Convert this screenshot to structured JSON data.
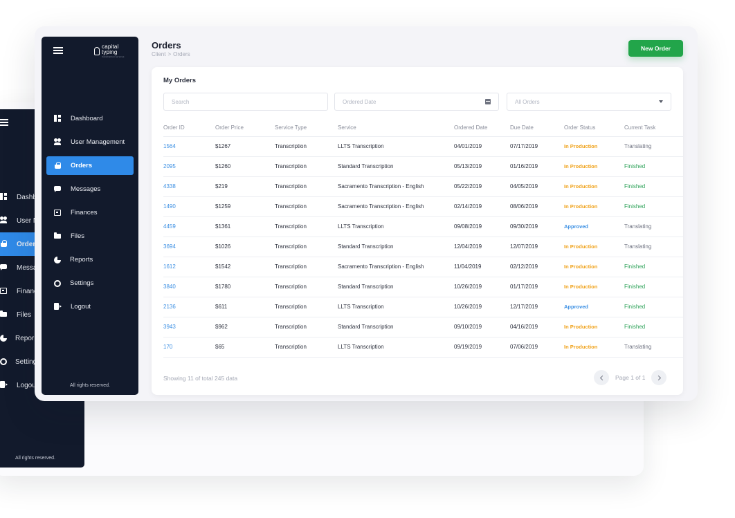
{
  "app": {
    "logo_text": "capital",
    "logo_text2": "typing",
    "logo_sub": "transcription services"
  },
  "sidebar": {
    "items": [
      {
        "label": "Dashboard",
        "icon": "dashboard-icon"
      },
      {
        "label": "User Management",
        "icon": "users-icon"
      },
      {
        "label": "Orders",
        "icon": "basket-icon",
        "active": true
      },
      {
        "label": "Messages",
        "icon": "chat-icon"
      },
      {
        "label": "Finances",
        "icon": "wallet-icon"
      },
      {
        "label": "Files",
        "icon": "folder-icon"
      },
      {
        "label": "Reports",
        "icon": "pie-chart-icon"
      },
      {
        "label": "Settings",
        "icon": "gear-icon"
      },
      {
        "label": "Logout",
        "icon": "logout-icon"
      }
    ],
    "footer": "All rights reserved."
  },
  "back_sidebar": {
    "items": [
      "Dashb",
      "User M",
      "Order",
      "Messa",
      "Financ",
      "Files",
      "Repor",
      "Setting",
      "Logou"
    ],
    "footer": "All rights reserved."
  },
  "header": {
    "title": "Orders",
    "breadcrumb": [
      "Client",
      ">",
      "Orders"
    ],
    "new_order_label": "New Order"
  },
  "card": {
    "title": "My Orders",
    "search_placeholder": "Search",
    "date_placeholder": "Ordered Date",
    "status_selected": "All Orders"
  },
  "table": {
    "columns": [
      "Order ID",
      "Order Price",
      "Service Type",
      "Service",
      "Ordered Date",
      "Due Date",
      "Order Status",
      "Current Task"
    ],
    "rows": [
      [
        "1564",
        "$1267",
        "Transcription",
        "LLTS Transcription",
        "04/01/2019",
        "07/17/2019",
        "In Production",
        "Translating"
      ],
      [
        "2095",
        "$1260",
        "Transcription",
        "Standard Transcription",
        "05/13/2019",
        "01/16/2019",
        "In Production",
        "Finished"
      ],
      [
        "4338",
        "$219",
        "Transcription",
        "Sacramento Transcription - English",
        "05/22/2019",
        "04/05/2019",
        "In Production",
        "Finished"
      ],
      [
        "1490",
        "$1259",
        "Transcription",
        "Sacramento Transcription - English",
        "02/14/2019",
        "08/06/2019",
        "In Production",
        "Finished"
      ],
      [
        "4459",
        "$1361",
        "Transcription",
        "LLTS Transcription",
        "09/08/2019",
        "09/30/2019",
        "Approved",
        "Translating"
      ],
      [
        "3694",
        "$1026",
        "Transcription",
        "Standard Transcription",
        "12/04/2019",
        "12/07/2019",
        "In Production",
        "Translating"
      ],
      [
        "1612",
        "$1542",
        "Transcription",
        "Sacramento Transcription - English",
        "11/04/2019",
        "02/12/2019",
        "In Production",
        "Finished"
      ],
      [
        "3840",
        "$1780",
        "Transcription",
        "Standard Transcription",
        "10/26/2019",
        "01/17/2019",
        "In Production",
        "Finished"
      ],
      [
        "2136",
        "$611",
        "Transcription",
        "LLTS Transcription",
        "10/26/2019",
        "12/17/2019",
        "Approved",
        "Finished"
      ],
      [
        "3943",
        "$962",
        "Transcription",
        "Standard Transcription",
        "09/10/2019",
        "04/16/2019",
        "In Production",
        "Finished"
      ],
      [
        "170",
        "$65",
        "Transcription",
        "LLTS Transcription",
        "09/19/2019",
        "07/06/2019",
        "In Production",
        "Translating"
      ]
    ]
  },
  "footer": {
    "showing": "Showing 11 of total 245 data",
    "page_info": "Page 1 of 1"
  },
  "colors": {
    "sidebar_bg": "#121a2c",
    "accent": "#2f8ae8",
    "button_green": "#22a54a",
    "status_production": "#f0a21a",
    "status_approved": "#3b8fe3",
    "task_finished": "#2fa35a"
  }
}
